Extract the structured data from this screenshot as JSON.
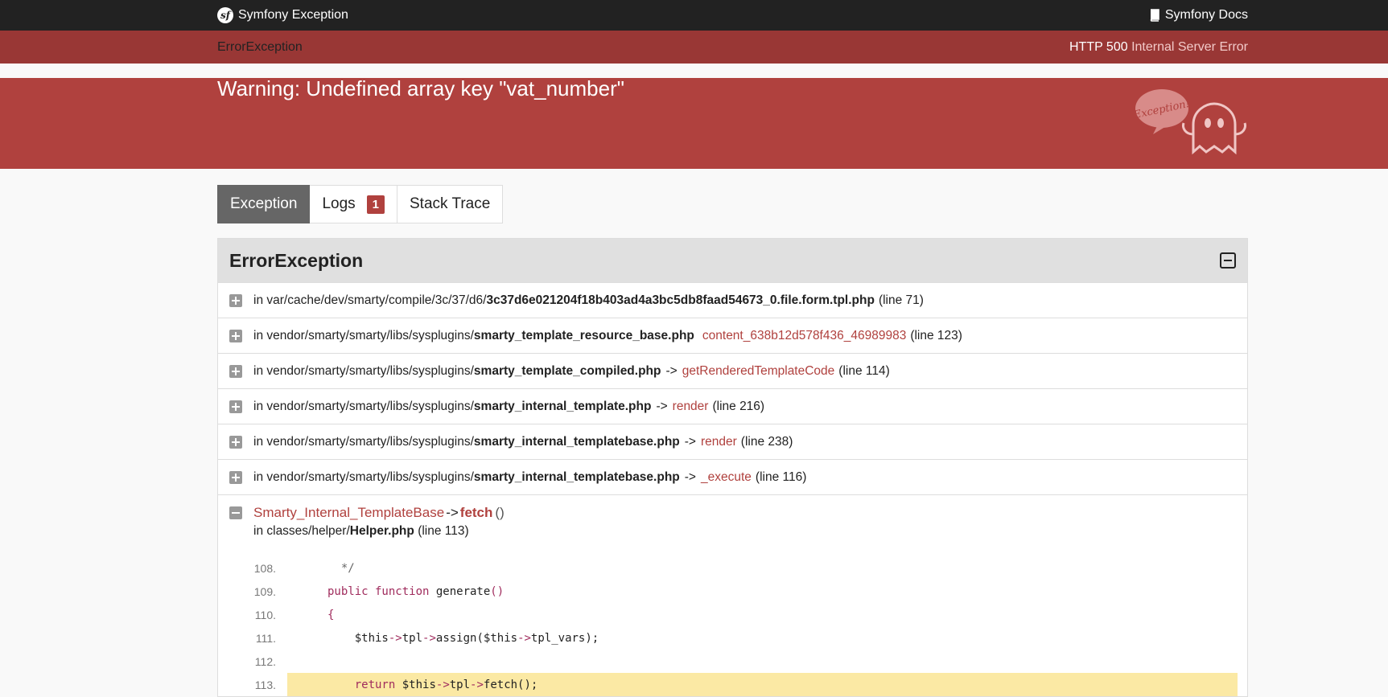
{
  "topbar": {
    "brand": "Symfony Exception",
    "docs_link": "Symfony Docs"
  },
  "header": {
    "exception_class": "ErrorException",
    "status_code": "HTTP 500",
    "status_text": "Internal Server Error",
    "message": "Warning: Undefined array key \"vat_number\""
  },
  "tabs": [
    {
      "label": "Exception",
      "active": true
    },
    {
      "label": "Logs",
      "badge": "1"
    },
    {
      "label": "Stack Trace"
    }
  ],
  "panel": {
    "title": "ErrorException"
  },
  "trace": [
    {
      "prefix": "in var/cache/dev/smarty/compile/3c/37/d6/",
      "file": "3c37d6e021204f18b403ad4a3bc5db8faad54673_0.file.form.tpl.php",
      "arrow": "",
      "func": "",
      "line": "(line 71)"
    },
    {
      "prefix": "in vendor/smarty/smarty/libs/sysplugins/",
      "file": "smarty_template_resource_base.php",
      "arrow": "",
      "func": "content_638b12d578f436_46989983",
      "line": "(line 123)"
    },
    {
      "prefix": "in vendor/smarty/smarty/libs/sysplugins/",
      "file": "smarty_template_compiled.php",
      "arrow": "->",
      "func": "getRenderedTemplateCode",
      "line": "(line 114)"
    },
    {
      "prefix": "in vendor/smarty/smarty/libs/sysplugins/",
      "file": "smarty_internal_template.php",
      "arrow": "->",
      "func": "render",
      "line": "(line 216)"
    },
    {
      "prefix": "in vendor/smarty/smarty/libs/sysplugins/",
      "file": "smarty_internal_templatebase.php",
      "arrow": "->",
      "func": "render",
      "line": "(line 238)"
    },
    {
      "prefix": "in vendor/smarty/smarty/libs/sysplugins/",
      "file": "smarty_internal_templatebase.php",
      "arrow": "->",
      "func": "_execute",
      "line": "(line 116)"
    }
  ],
  "expanded": {
    "class_name": "Smarty_Internal_TemplateBase",
    "arrow": "->",
    "method": "fetch",
    "parens": "()",
    "file_prefix": "in classes/helper/",
    "file": "Helper.php",
    "line": "(line 113)"
  },
  "code": [
    {
      "n": "108.",
      "indent": "  ",
      "parts": [
        {
          "t": "*/",
          "c": "cm"
        }
      ]
    },
    {
      "n": "109.",
      "indent": "",
      "parts": [
        {
          "t": "public function ",
          "c": "kw"
        },
        {
          "t": "generate",
          "c": ""
        },
        {
          "t": "()",
          "c": "pn"
        }
      ]
    },
    {
      "n": "110.",
      "indent": "",
      "parts": [
        {
          "t": "{",
          "c": "pn"
        }
      ]
    },
    {
      "n": "111.",
      "indent": "    ",
      "parts": [
        {
          "t": "$this",
          "c": ""
        },
        {
          "t": "->",
          "c": "op"
        },
        {
          "t": "tpl",
          "c": ""
        },
        {
          "t": "->",
          "c": "op"
        },
        {
          "t": "assign(",
          "c": ""
        },
        {
          "t": "$this",
          "c": ""
        },
        {
          "t": "->",
          "c": "op"
        },
        {
          "t": "tpl_vars);",
          "c": ""
        }
      ]
    },
    {
      "n": "112.",
      "indent": "",
      "parts": []
    },
    {
      "n": "113.",
      "indent": "    ",
      "highlight": true,
      "parts": [
        {
          "t": "return ",
          "c": "kw"
        },
        {
          "t": "$this",
          "c": ""
        },
        {
          "t": "->",
          "c": "op"
        },
        {
          "t": "tpl",
          "c": ""
        },
        {
          "t": "->",
          "c": "op"
        },
        {
          "t": "fetch();",
          "c": ""
        }
      ]
    }
  ]
}
